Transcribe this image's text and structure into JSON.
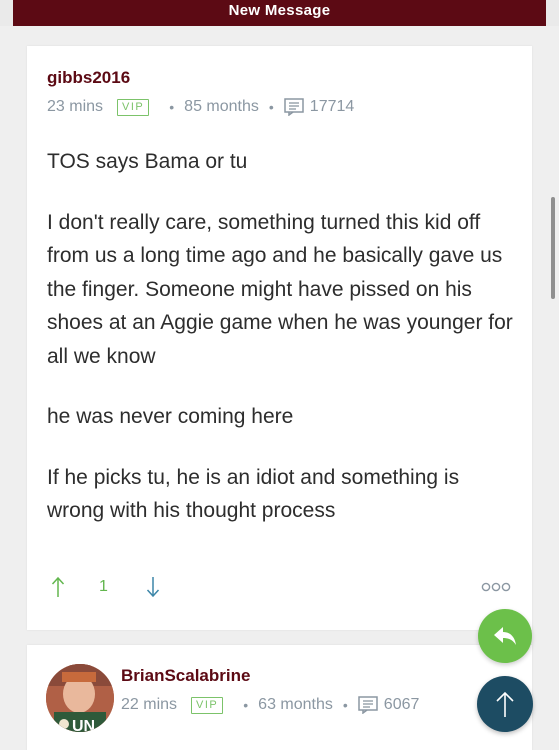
{
  "header": {
    "title": "New Message"
  },
  "posts": [
    {
      "username": "gibbs2016",
      "time": "23 mins",
      "badge": "VIP",
      "tenure": "85 months",
      "post_count": "17714",
      "paragraphs": [
        "TOS says Bama or tu",
        "I don't really care, something turned this kid off from us a long time ago and he basically gave us the finger. Someone might have pissed on his shoes at an Aggie game when he was younger for all we know",
        "he was never coming here",
        "If he picks tu, he is an idiot and something is wrong with his thought process"
      ],
      "vote_count": "1",
      "more_label": "ooo"
    },
    {
      "username": "BrianScalabrine",
      "time": "22 mins",
      "badge": "VIP",
      "tenure": "63 months",
      "post_count": "6067",
      "avatar_text": "UN"
    }
  ],
  "icons": {
    "upvote": "arrow-up-icon",
    "downvote": "arrow-down-icon",
    "posts": "posts-count-icon",
    "reply": "reply-icon",
    "scroll_top": "arrow-up-icon"
  },
  "colors": {
    "brand": "#5c0a14",
    "accent_green": "#6cc04a",
    "meta_gray": "#8b97a2",
    "scroll_top_button": "#1d4c63"
  }
}
